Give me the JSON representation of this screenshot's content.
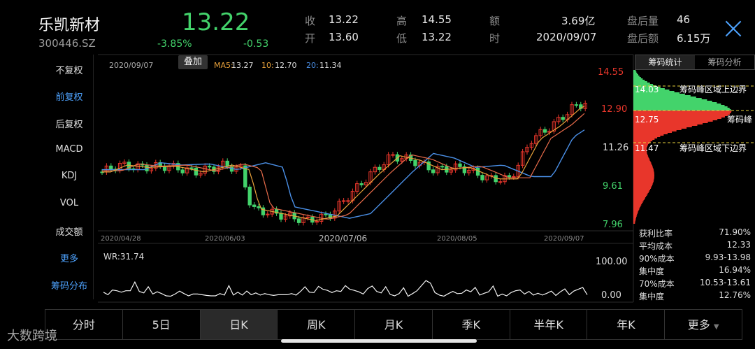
{
  "stock": {
    "name": "乐凯新材",
    "code": "300446.SZ",
    "price": "13.22",
    "pct": "-3.85%",
    "change": "-0.53"
  },
  "quote": {
    "close_l": "收",
    "close_v": "13.22",
    "open_l": "开",
    "open_v": "13.60",
    "high_l": "高",
    "high_v": "14.55",
    "low_l": "低",
    "low_v": "13.22",
    "amt_l": "额",
    "amt_v": "3.69亿",
    "time_l": "时",
    "time_v": "2020/09/07",
    "ah_vol_l": "盘后量",
    "ah_vol_v": "46",
    "ah_amt_l": "盘后额",
    "ah_amt_v": "6.15万"
  },
  "left_menu": [
    "不复权",
    "前复权",
    "后复权",
    "MACD",
    "KDJ",
    "VOL",
    "成交额",
    "更多",
    "筹码分布"
  ],
  "main_chart": {
    "date": "2020/09/07",
    "overlay_label": "叠加",
    "ma": {
      "ma5_label": "MA5:",
      "ma5_val": "13.27",
      "ma10_label": "10:",
      "ma10_val": "12.70",
      "ma20_label": "20:",
      "ma20_val": "11.34"
    },
    "y_ticks": [
      "14.55",
      "12.90",
      "11.26",
      "9.61",
      "7.96"
    ],
    "x_ticks": [
      "2020/04/28",
      "2020/06/03",
      "2020/07/06",
      "2020/08/05",
      "2020/09/07"
    ],
    "wr_label": "WR:31.74",
    "wr_ticks": [
      "100.00",
      "0.00"
    ]
  },
  "chart_data": {
    "type": "line",
    "price_range": [
      7.96,
      14.55
    ],
    "wr": [
      88,
      95,
      82,
      84,
      88,
      84,
      84,
      60,
      86,
      90,
      73,
      93,
      87,
      92,
      98,
      99,
      93,
      85,
      92,
      98,
      93,
      93,
      95,
      97,
      98,
      98,
      92,
      96,
      70,
      96,
      88,
      96,
      85,
      95,
      90,
      96,
      92,
      95,
      97,
      95,
      95,
      95,
      92,
      96,
      86,
      73,
      88,
      89,
      72,
      80,
      83,
      89,
      84,
      86,
      70,
      80,
      83,
      87,
      93,
      78,
      71,
      86,
      90,
      73,
      94,
      98,
      92,
      76,
      99,
      92,
      84,
      70,
      56,
      63,
      89,
      96,
      99,
      92,
      86,
      92,
      91,
      82,
      87,
      75,
      96,
      91,
      87,
      71,
      99,
      93,
      98,
      89,
      84,
      82,
      93,
      86,
      96,
      91,
      96,
      91,
      85,
      97,
      87,
      79,
      95,
      85,
      80,
      75,
      95
    ]
  },
  "chip": {
    "tabs": [
      "筹码统计",
      "筹码分析"
    ],
    "upper_val": "14.03",
    "upper_label": "筹码峰区域上边界",
    "peak_val": "12.75",
    "peak_label": "筹码峰",
    "lower_val": "11.47",
    "lower_label": "筹码峰区域下边界",
    "stats": [
      {
        "k": "获利比率",
        "v": "71.90%"
      },
      {
        "k": "平均成本",
        "v": "12.33"
      },
      {
        "k": "90%成本",
        "v": "9.93-13.98"
      },
      {
        "k": "集中度",
        "v": "16.94%"
      },
      {
        "k": "70%成本",
        "v": "10.53-13.61"
      },
      {
        "k": "集中度",
        "v": "12.76%"
      }
    ]
  },
  "tabs": [
    "分时",
    "5日",
    "日K",
    "周K",
    "月K",
    "季K",
    "半年K",
    "年K",
    "更多"
  ],
  "watermark": "大数跨境",
  "colors": {
    "up": "#e8362b",
    "down": "#43d36b",
    "ma5": "#e9a23b",
    "ma10": "#e86b4a",
    "ma20": "#4a8fe6",
    "accent": "#4ea3ff"
  }
}
